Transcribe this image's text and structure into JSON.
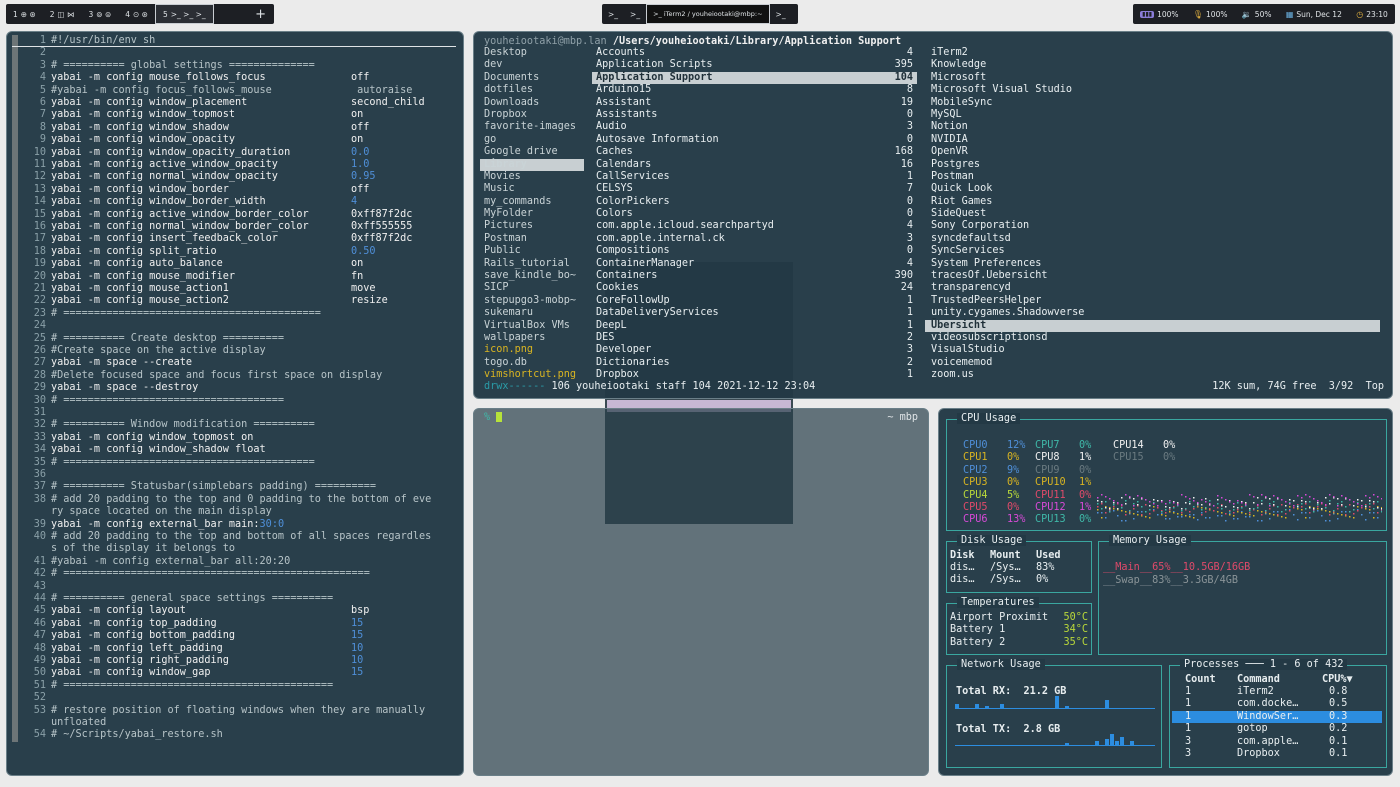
{
  "topbar": {
    "workspaces": [
      {
        "num": "1",
        "active": false
      },
      {
        "num": "2",
        "active": false
      },
      {
        "num": "3",
        "active": false
      },
      {
        "num": "4",
        "active": false
      },
      {
        "num": "5",
        "active": true
      }
    ],
    "add_label": "+",
    "window_title": "iTerm2 / youheiootaki@mbp:~",
    "stats": {
      "battery": "100%",
      "mic": "100%",
      "volume": "50%",
      "date": "Sun, Dec 12",
      "time": "23:10"
    }
  },
  "vim": {
    "lines": [
      {
        "n": "1",
        "t": "#!/usr/bin/env sh",
        "v": "",
        "k": "com"
      },
      {
        "n": "2",
        "t": "",
        "v": ""
      },
      {
        "n": "3",
        "t": "# ========== global settings ==============",
        "v": "",
        "k": "com"
      },
      {
        "n": "4",
        "t": "yabai -m config mouse_follows_focus",
        "v": "off"
      },
      {
        "n": "5",
        "t": "#yabai -m config focus_follows_mouse",
        "v": " autoraise",
        "k": "com"
      },
      {
        "n": "6",
        "t": "yabai -m config window_placement",
        "v": "second_child"
      },
      {
        "n": "7",
        "t": "yabai -m config window_topmost",
        "v": "on"
      },
      {
        "n": "8",
        "t": "yabai -m config window_shadow",
        "v": "off"
      },
      {
        "n": "9",
        "t": "yabai -m config window_opacity",
        "v": "on"
      },
      {
        "n": "10",
        "t": "yabai -m config window_opacity_duration",
        "v": "0.0",
        "k": "num"
      },
      {
        "n": "11",
        "t": "yabai -m config active_window_opacity",
        "v": "1.0",
        "k": "num"
      },
      {
        "n": "12",
        "t": "yabai -m config normal_window_opacity",
        "v": "0.95",
        "k": "num"
      },
      {
        "n": "13",
        "t": "yabai -m config window_border",
        "v": "off"
      },
      {
        "n": "14",
        "t": "yabai -m config window_border_width",
        "v": "4",
        "k": "num"
      },
      {
        "n": "15",
        "t": "yabai -m config active_window_border_color",
        "v": "0xff87f2dc"
      },
      {
        "n": "16",
        "t": "yabai -m config normal_window_border_color",
        "v": "0xff555555"
      },
      {
        "n": "17",
        "t": "yabai -m config insert_feedback_color",
        "v": "0xff87f2dc"
      },
      {
        "n": "18",
        "t": "yabai -m config split_ratio",
        "v": "0.50",
        "k": "num"
      },
      {
        "n": "19",
        "t": "yabai -m config auto_balance",
        "v": "on"
      },
      {
        "n": "20",
        "t": "yabai -m config mouse_modifier",
        "v": "fn"
      },
      {
        "n": "21",
        "t": "yabai -m config mouse_action1",
        "v": "move"
      },
      {
        "n": "22",
        "t": "yabai -m config mouse_action2",
        "v": "resize"
      },
      {
        "n": "23",
        "t": "# ==========================================",
        "v": "",
        "k": "com"
      },
      {
        "n": "24",
        "t": "",
        "v": ""
      },
      {
        "n": "25",
        "t": "# ========== Create desktop ==========",
        "v": "",
        "k": "com"
      },
      {
        "n": "26",
        "t": "#Create space on the active display",
        "v": "",
        "k": "com"
      },
      {
        "n": "27",
        "t": "yabai -m space --create",
        "v": ""
      },
      {
        "n": "28",
        "t": "#Delete focused space and focus first space on display",
        "v": "",
        "k": "com"
      },
      {
        "n": "29",
        "t": "yabai -m space --destroy",
        "v": ""
      },
      {
        "n": "30",
        "t": "# ====================================",
        "v": "",
        "k": "com"
      },
      {
        "n": "31",
        "t": "",
        "v": ""
      },
      {
        "n": "32",
        "t": "# ========== Window modification ==========",
        "v": "",
        "k": "com"
      },
      {
        "n": "33",
        "t": "yabai -m config window_topmost on",
        "v": ""
      },
      {
        "n": "34",
        "t": "yabai -m config window_shadow float",
        "v": ""
      },
      {
        "n": "35",
        "t": "# =========================================",
        "v": "",
        "k": "com"
      },
      {
        "n": "36",
        "t": "",
        "v": ""
      },
      {
        "n": "37",
        "t": "# ========== Statusbar(simplebars padding) ==========",
        "v": "",
        "k": "com"
      },
      {
        "n": "38",
        "t": "# add 20 padding to the top and 0 padding to the bottom of eve",
        "v": "",
        "k": "com"
      },
      {
        "n": "",
        "t": "ry space located on the main display",
        "v": "",
        "k": "com"
      },
      {
        "n": "39",
        "t": "yabai -m config external_bar main:",
        "v": "",
        "extra": "30:0"
      },
      {
        "n": "40",
        "t": "# add 20 padding to the top and bottom of all spaces regardles",
        "v": "",
        "k": "com"
      },
      {
        "n": "",
        "t": "s of the display it belongs to",
        "v": "",
        "k": "com"
      },
      {
        "n": "41",
        "t": "#yabai -m config external_bar all:20:20",
        "v": "",
        "k": "com"
      },
      {
        "n": "42",
        "t": "# ==================================================",
        "v": "",
        "k": "com"
      },
      {
        "n": "43",
        "t": "",
        "v": ""
      },
      {
        "n": "44",
        "t": "# ========== general space settings ==========",
        "v": "",
        "k": "com"
      },
      {
        "n": "45",
        "t": "yabai -m config layout",
        "v": "bsp"
      },
      {
        "n": "46",
        "t": "yabai -m config top_padding",
        "v": "15",
        "k": "num"
      },
      {
        "n": "47",
        "t": "yabai -m config bottom_padding",
        "v": "15",
        "k": "num"
      },
      {
        "n": "48",
        "t": "yabai -m config left_padding",
        "v": "10",
        "k": "num"
      },
      {
        "n": "49",
        "t": "yabai -m config right_padding",
        "v": "10",
        "k": "num"
      },
      {
        "n": "50",
        "t": "yabai -m config window_gap",
        "v": "15",
        "k": "num"
      },
      {
        "n": "51",
        "t": "# ============================================",
        "v": "",
        "k": "com"
      },
      {
        "n": "52",
        "t": "",
        "v": ""
      },
      {
        "n": "53",
        "t": "# restore position of floating windows when they are manually",
        "v": "",
        "k": "com"
      },
      {
        "n": "",
        "t": "unfloated",
        "v": "",
        "k": "com"
      },
      {
        "n": "54",
        "t": "# ~/Scripts/yabai_restore.sh",
        "v": "",
        "k": "com"
      }
    ]
  },
  "ranger": {
    "host": "youheiootaki@mbp.lan",
    "path": "/Users/youheiootaki/Library/",
    "current": "Application Support",
    "col1": [
      "Desktop",
      "dev",
      "Documents",
      "dotfiles",
      "Downloads",
      "Dropbox",
      "favorite-images",
      "go",
      "Google drive",
      "Library",
      "Movies",
      "Music",
      "my_commands",
      "MyFolder",
      "Pictures",
      "Postman",
      "Public",
      "Rails_tutorial",
      "save_kindle_bo~",
      "SICP",
      "stepupgo3-mobp~",
      "sukemaru",
      "VirtualBox VMs",
      "wallpapers",
      "icon.png",
      "togo.db",
      "vimshortcut.png"
    ],
    "col1_sel": 9,
    "col2": [
      {
        "name": "Accounts",
        "count": "4"
      },
      {
        "name": "Application Scripts",
        "count": "395"
      },
      {
        "name": "Application Support",
        "count": "104"
      },
      {
        "name": "Arduino15",
        "count": "8"
      },
      {
        "name": "Assistant",
        "count": "19"
      },
      {
        "name": "Assistants",
        "count": "0"
      },
      {
        "name": "Audio",
        "count": "3"
      },
      {
        "name": "Autosave Information",
        "count": "0"
      },
      {
        "name": "Caches",
        "count": "168"
      },
      {
        "name": "Calendars",
        "count": "16"
      },
      {
        "name": "CallServices",
        "count": "1"
      },
      {
        "name": "CELSYS",
        "count": "7"
      },
      {
        "name": "ColorPickers",
        "count": "0"
      },
      {
        "name": "Colors",
        "count": "0"
      },
      {
        "name": "com.apple.icloud.searchpartyd",
        "count": "4"
      },
      {
        "name": "com.apple.internal.ck",
        "count": "3"
      },
      {
        "name": "Compositions",
        "count": "0"
      },
      {
        "name": "ContainerManager",
        "count": "4"
      },
      {
        "name": "Containers",
        "count": "390"
      },
      {
        "name": "Cookies",
        "count": "24"
      },
      {
        "name": "CoreFollowUp",
        "count": "1"
      },
      {
        "name": "DataDeliveryServices",
        "count": "1"
      },
      {
        "name": "DeepL",
        "count": "1"
      },
      {
        "name": "DES",
        "count": "2"
      },
      {
        "name": "Developer",
        "count": "3"
      },
      {
        "name": "Dictionaries",
        "count": "2"
      },
      {
        "name": "Dropbox",
        "count": "1"
      }
    ],
    "col2_sel": 2,
    "col3": [
      "iTerm2",
      "Knowledge",
      "Microsoft",
      "Microsoft Visual Studio",
      "MobileSync",
      "MySQL",
      "Notion",
      "NVIDIA",
      "OpenVR",
      "Postgres",
      "Postman",
      "Quick Look",
      "Riot Games",
      "SideQuest",
      "Sony Corporation",
      "syncdefaultsd",
      "SyncServices",
      "System Preferences",
      "tracesOf.Uebersicht",
      "transparencyd",
      "TrustedPeersHelper",
      "unity.cygames.Shadowverse",
      "Übersicht",
      "videosubscriptionsd",
      "VisualStudio",
      "voicememod",
      "zoom.us"
    ],
    "col3_sel": 22,
    "footer": {
      "perm": "drwx------",
      "info": " 106 youheiootaki staff 104 2021-12-12 23:04",
      "right": "12K sum, 74G free  3/92  Top"
    }
  },
  "shell": {
    "prompt": "%",
    "host": "~ mbp"
  },
  "gotop": {
    "cpu_title": "CPU Usage",
    "cpus": [
      {
        "name": "CPU0",
        "val": "12%",
        "color": "#4f8fd8"
      },
      {
        "name": "CPU1",
        "val": "0%",
        "color": "#d8b422"
      },
      {
        "name": "CPU2",
        "val": "9%",
        "color": "#4f8fd8"
      },
      {
        "name": "CPU3",
        "val": "0%",
        "color": "#d8b422"
      },
      {
        "name": "CPU4",
        "val": "5%",
        "color": "#b9d83a"
      },
      {
        "name": "CPU5",
        "val": "0%",
        "color": "#e04a6a"
      },
      {
        "name": "CPU6",
        "val": "13%",
        "color": "#d84ad8"
      },
      {
        "name": "CPU7",
        "val": "0%",
        "color": "#3fb8a8"
      },
      {
        "name": "CPU8",
        "val": "1%",
        "color": "#f0f0f0"
      },
      {
        "name": "CPU9",
        "val": "0%",
        "color": "#6a7a80"
      },
      {
        "name": "CPU10",
        "val": "1%",
        "color": "#d8b422"
      },
      {
        "name": "CPU11",
        "val": "0%",
        "color": "#e04a6a"
      },
      {
        "name": "CPU12",
        "val": "1%",
        "color": "#d84ad8"
      },
      {
        "name": "CPU13",
        "val": "0%",
        "color": "#3fb8a8"
      },
      {
        "name": "CPU14",
        "val": "0%",
        "color": "#f0f0f0"
      },
      {
        "name": "CPU15",
        "val": "0%",
        "color": "#6a7a80"
      }
    ],
    "disk": {
      "title": "Disk Usage",
      "headers": [
        "Disk",
        "Mount",
        "Used"
      ],
      "rows": [
        [
          "dis…",
          "/Sys…",
          "83%"
        ],
        [
          "dis…",
          "/Sys…",
          "0%"
        ]
      ]
    },
    "memory": {
      "title": "Memory Usage",
      "main_label": "Main",
      "main_pct": "65%",
      "main_val": "10.5GB/16GB",
      "swap_label": "Swap",
      "swap_pct": "83%",
      "swap_val": "3.3GB/4GB"
    },
    "temps": {
      "title": "Temperatures",
      "rows": [
        [
          "Airport Proximit",
          "50°C"
        ],
        [
          "Battery 1",
          "34°C"
        ],
        [
          "Battery 2",
          "35°C"
        ]
      ]
    },
    "network": {
      "title": "Network Usage",
      "rx_label": "Total RX:",
      "rx_val": "21.2 GB",
      "tx_label": "Total TX:",
      "tx_val": "2.8 GB"
    },
    "processes": {
      "title": "Processes",
      "range": "1 - 6 of 432",
      "headers": [
        "Count",
        "Command",
        "CPU%▼"
      ],
      "rows": [
        [
          "1",
          "iTerm2",
          "0.8"
        ],
        [
          "1",
          "com.docke…",
          "0.5"
        ],
        [
          "1",
          "WindowSer…",
          "0.3"
        ],
        [
          "1",
          "gotop",
          "0.2"
        ],
        [
          "3",
          "com.apple…",
          "0.1"
        ],
        [
          "3",
          "Dropbox",
          "0.1"
        ]
      ],
      "selected": 2
    }
  }
}
